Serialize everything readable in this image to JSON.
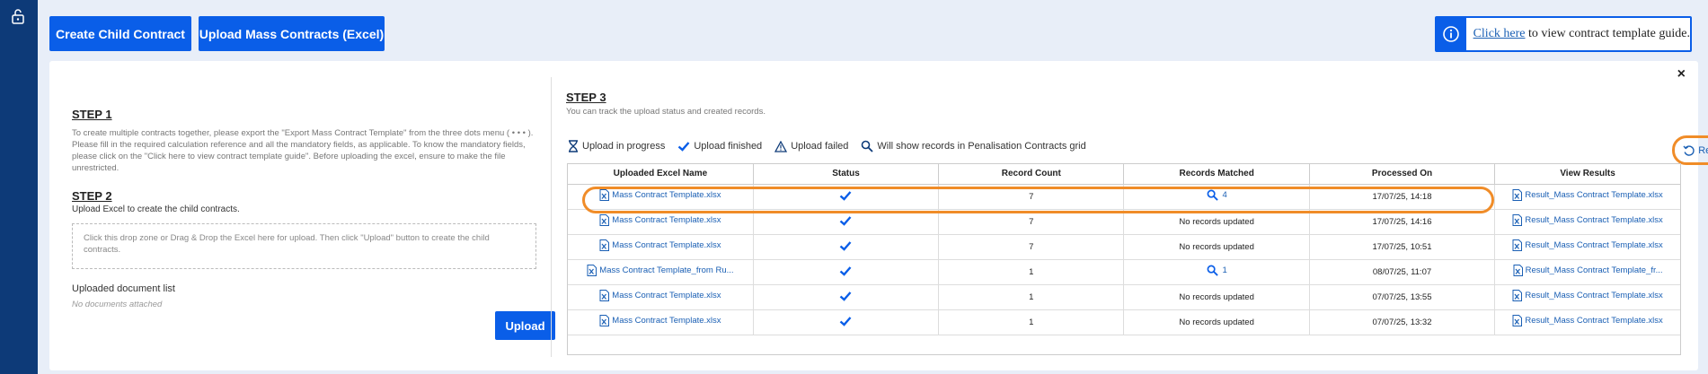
{
  "toolbar": {
    "create_child_label": "Create Child Contract",
    "upload_mass_label": "Upload Mass Contracts (Excel)"
  },
  "guide": {
    "link_text": "Click here",
    "rest_text": " to view contract template guide."
  },
  "panel": {
    "close_label": "×",
    "step1": {
      "title": "STEP 1",
      "text": "To create multiple contracts together, please export the \"Export Mass Contract Template\" from the three dots menu ( • • • ). Please fill in the required calculation reference and all the mandatory fields, as applicable. To know the mandatory fields, please click on the \"Click here to view contract template guide\". Before uploading the excel, ensure to make the file unrestricted."
    },
    "step2": {
      "title": "STEP 2",
      "text": "Upload Excel to create the child contracts.",
      "dropzone_text": "Click this drop zone or Drag & Drop the Excel here for upload. Then click \"Upload\" button to create the child contracts.",
      "doc_list_title": "Uploaded document list",
      "doc_list_empty": "No documents attached",
      "upload_label": "Upload"
    },
    "step3": {
      "title": "STEP 3",
      "text": "You can track the upload status and created records.",
      "legend": {
        "in_progress": "Upload in progress",
        "finished": "Upload finished",
        "failed": "Upload failed",
        "show_records": "Will show records in Penalisation Contracts grid"
      },
      "refresh_label": "Refresh",
      "columns": [
        "Uploaded Excel Name",
        "Status",
        "Record Count",
        "Records Matched",
        "Processed On",
        "View Results"
      ],
      "rows": [
        {
          "file": "Mass Contract Template.xlsx",
          "count": "7",
          "matched": "4",
          "matched_link": true,
          "processed": "17/07/25, 14:18",
          "result": "Result_Mass Contract Template.xlsx"
        },
        {
          "file": "Mass Contract Template.xlsx",
          "count": "7",
          "matched": "No records updated",
          "matched_link": false,
          "processed": "17/07/25, 14:16",
          "result": "Result_Mass Contract Template.xlsx"
        },
        {
          "file": "Mass Contract Template.xlsx",
          "count": "7",
          "matched": "No records updated",
          "matched_link": false,
          "processed": "17/07/25, 10:51",
          "result": "Result_Mass Contract Template.xlsx"
        },
        {
          "file": "Mass Contract Template_from Ru...",
          "count": "1",
          "matched": "1",
          "matched_link": true,
          "processed": "08/07/25, 11:07",
          "result": "Result_Mass Contract Template_fr..."
        },
        {
          "file": "Mass Contract Template.xlsx",
          "count": "1",
          "matched": "No records updated",
          "matched_link": false,
          "processed": "07/07/25, 13:55",
          "result": "Result_Mass Contract Template.xlsx"
        },
        {
          "file": "Mass Contract Template.xlsx",
          "count": "1",
          "matched": "No records updated",
          "matched_link": false,
          "processed": "07/07/25, 13:32",
          "result": "Result_Mass Contract Template.xlsx"
        }
      ]
    }
  },
  "colors": {
    "primary": "#0a5ee8",
    "navy": "#0d3a78",
    "highlight": "#f08c28",
    "link": "#1a5fb4"
  }
}
